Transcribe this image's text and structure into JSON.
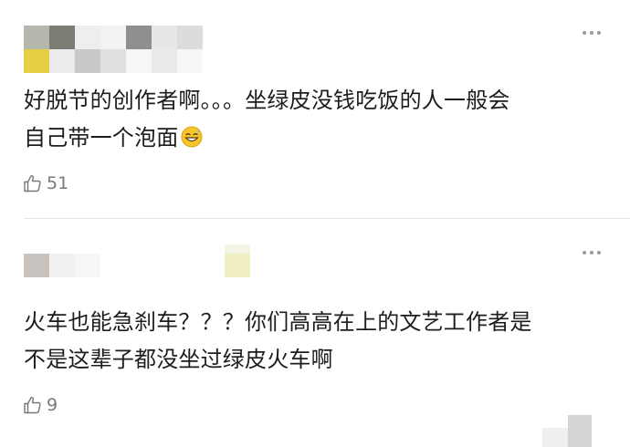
{
  "comments": [
    {
      "text_line1": "好脱节的创作者啊。。。坐绿皮没钱吃饭的人一般会",
      "text_line2": "自己带一个泡面",
      "emoji": "grinning-sweat-emoji",
      "like_icon": "thumbs-up-icon",
      "likes": "51",
      "more_icon": "more-dots-icon"
    },
    {
      "text_line1": "火车也能急刹车？？？你们高高在上的文艺工作者是",
      "text_line2": "不是这辈子都没坐过绿皮火车啊",
      "like_icon": "thumbs-up-icon",
      "likes": "9",
      "more_icon": "more-dots-icon"
    }
  ],
  "colors": {
    "text": "#1d1d1d",
    "meta": "#7a7a7a",
    "divider": "#e6e6e6"
  }
}
